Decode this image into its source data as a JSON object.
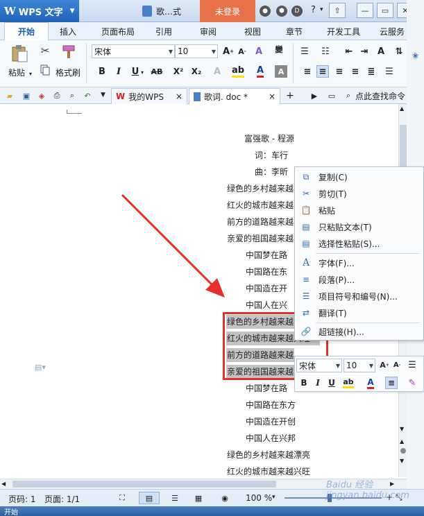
{
  "app": {
    "name": "WPS 文字",
    "logo": "W",
    "doc_title_short": "歌…式",
    "login_label": "未登录"
  },
  "menu": {
    "tabs": [
      "开始",
      "插入",
      "页面布局",
      "引用",
      "审阅",
      "视图",
      "章节",
      "开发工具",
      "云服务"
    ]
  },
  "ribbon": {
    "paste_label": "粘贴",
    "format_painter_label": "格式刷",
    "font_name": "宋体",
    "font_size": "10",
    "change_case_label": "變"
  },
  "quickbar": {
    "tabs": [
      {
        "label": "我的WPS"
      },
      {
        "label": "歌词. doc *"
      }
    ],
    "search_label": "点此查找命令"
  },
  "document": {
    "lines": [
      "富强歌 - 程源",
      "词：车行",
      "曲：李昕",
      "绿色的乡村越来越",
      "红火的城市越来越",
      "前方的道路越来越",
      "亲爱的祖国越来越",
      "中国梦在路",
      "中国路在东",
      "中国造在开",
      "中国人在兴",
      "绿色的乡村越来越",
      "红火的城市越来越兴旺",
      "前方的道路越来越宽广",
      "亲爱的祖国越来越",
      "中国梦在路",
      "中国路在东方",
      "中国造在开创",
      "中国人在兴邦",
      "绿色的乡村越来越漂亮",
      "红火的城市越来越兴旺"
    ]
  },
  "context_menu": {
    "items": [
      {
        "label": "复制(C)",
        "icon": "copy-icon"
      },
      {
        "label": "剪切(T)",
        "icon": "scissors-icon"
      },
      {
        "label": "粘贴",
        "icon": "paste-icon"
      },
      {
        "label": "只粘贴文本(T)",
        "icon": "paste-text-icon"
      },
      {
        "label": "选择性粘贴(S)...",
        "icon": "paste-special-icon"
      },
      {
        "label": "字体(F)...",
        "icon": "font-icon"
      },
      {
        "label": "段落(P)...",
        "icon": "paragraph-icon"
      },
      {
        "label": "项目符号和编号(N)...",
        "icon": "bullets-icon"
      },
      {
        "label": "翻译(T)",
        "icon": "translate-icon"
      },
      {
        "label": "超链接(H)...",
        "icon": "hyperlink-icon"
      }
    ]
  },
  "mini_toolbar": {
    "font_name": "宋体",
    "font_size": "10"
  },
  "status": {
    "page_label": "页码: 1",
    "pages_label": "页面: 1/1",
    "zoom": "100 %"
  },
  "taskbar": {
    "start_label": "开始"
  },
  "watermark": "Baidu 经验 jingyan.baidu.com",
  "colors": {
    "accent": "#1e62b8",
    "login": "#e8714a",
    "highlight": "#c4c4c4",
    "annotation": "#e4302c"
  }
}
